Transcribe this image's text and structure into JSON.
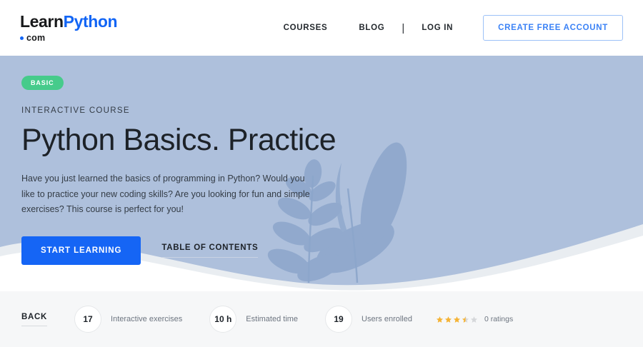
{
  "header": {
    "logo": {
      "learn": "Learn",
      "python": "Python",
      "com": "com",
      "dot_icon": "bullet-dot-icon"
    },
    "nav": [
      {
        "label": "COURSES",
        "name": "nav-link-courses"
      },
      {
        "label": "BLOG",
        "name": "nav-link-blog"
      },
      {
        "label": "LOG IN",
        "name": "nav-link-login"
      }
    ],
    "separator": "|",
    "cta_label": "CREATE FREE ACCOUNT"
  },
  "hero": {
    "badge": "BASIC",
    "eyebrow": "INTERACTIVE COURSE",
    "title": "Python Basics. Practice",
    "description": "Have you just learned the basics of programming in Python? Would you like to practice your new coding skills? Are you looking for fun and simple exercises? This course is perfect for you!",
    "primary_button": "START LEARNING",
    "secondary_link": "TABLE OF CONTENTS",
    "background_color": "#aec0dc",
    "illustration": "plant-leaves-illustration"
  },
  "stats": {
    "back_label": "BACK",
    "items": [
      {
        "value": "17",
        "label": "Interactive exercises",
        "name": "stat-interactive-exercises"
      },
      {
        "value": "10 h",
        "label": "Estimated time",
        "name": "stat-estimated-time"
      },
      {
        "value": "19",
        "label": "Users enrolled",
        "name": "stat-users-enrolled"
      }
    ],
    "rating": {
      "stars_filled": 3.5,
      "stars_total": 5,
      "count_label": "0 ratings",
      "star_color": "#f5b335",
      "empty_color": "#d5d7da"
    }
  },
  "colors": {
    "brand_blue": "#1265f5",
    "badge_green": "#46cb8b",
    "hero_bg": "#aec0dc",
    "stats_bg": "#f6f7f8"
  }
}
